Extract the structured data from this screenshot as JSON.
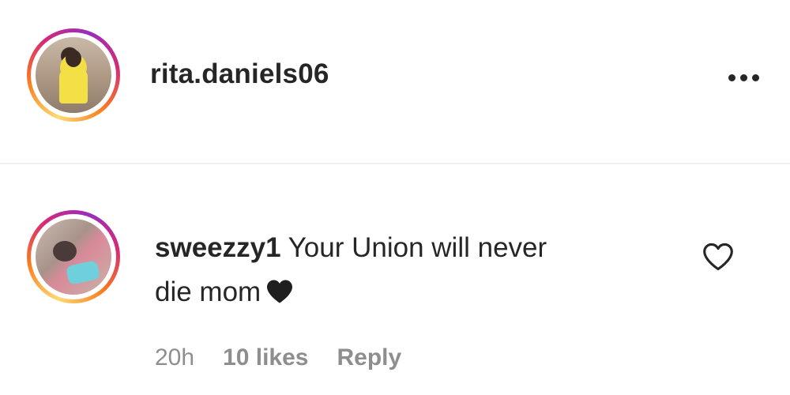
{
  "post_header": {
    "username": "rita.daniels06",
    "more_icon": "more-horizontal-icon"
  },
  "comment": {
    "username": "sweezzy1",
    "text_line1": "Your Union will never",
    "text_line2": "die mom",
    "emoji_icon": "black-heart-icon",
    "like_icon": "heart-outline-icon",
    "time": "20h",
    "likes": "10 likes",
    "reply_label": "Reply"
  },
  "colors": {
    "text": "#262626",
    "muted": "#8e8e8e",
    "divider": "#efefef",
    "story_ring_start": "#feda75",
    "story_ring_mid": "#d62976",
    "story_ring_end": "#962fbf"
  }
}
